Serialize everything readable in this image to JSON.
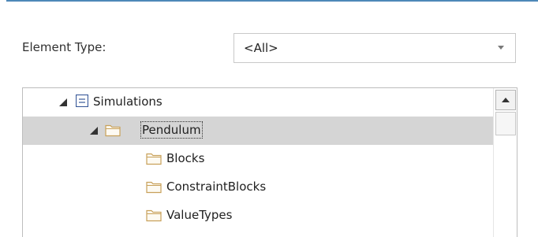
{
  "filter": {
    "element_type_label": "Element Type:",
    "element_type_value": "<All>"
  },
  "tree": {
    "items": [
      {
        "label": "Simulations",
        "icon": "package-icon",
        "expanded": true,
        "selected": false
      },
      {
        "label": "Pendulum",
        "icon": "folder-icon",
        "expanded": true,
        "selected": true
      },
      {
        "label": "Blocks",
        "icon": "folder-icon",
        "selected": false
      },
      {
        "label": "ConstraintBlocks",
        "icon": "folder-icon",
        "selected": false
      },
      {
        "label": "ValueTypes",
        "icon": "folder-icon",
        "selected": false
      }
    ]
  },
  "colors": {
    "accent_border": "#4e88b8",
    "selection": "#d5d5d5",
    "icon_outline": "#c8a15a"
  }
}
